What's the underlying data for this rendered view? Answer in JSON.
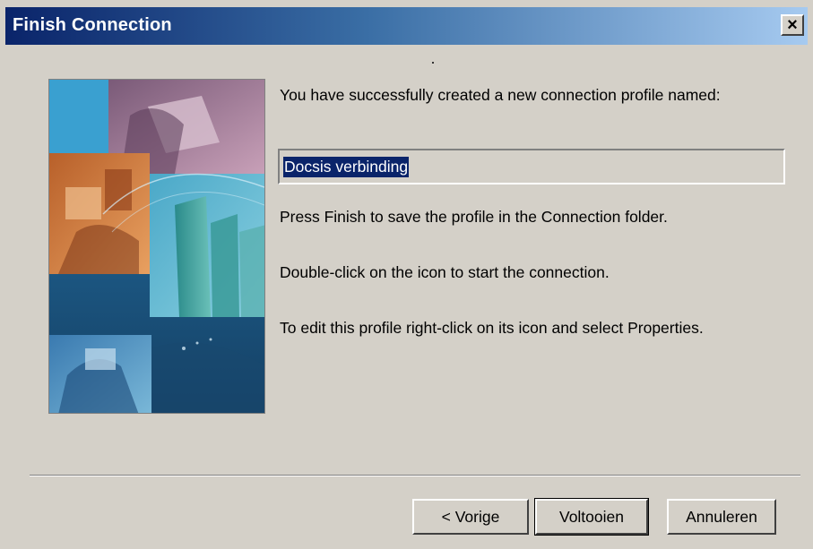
{
  "window": {
    "title": "Finish Connection",
    "close_glyph": "×"
  },
  "content": {
    "intro_text": "You have successfully created a new connection profile named:",
    "profile_name": "Docsis verbinding",
    "line_finish": "Press Finish to save the profile in the Connection folder.",
    "line_doubleclick": "Double-click on the icon to start the connection.",
    "line_edit": "To edit this profile right-click on its icon and select Properties."
  },
  "buttons": {
    "back_label": "< Vorige",
    "finish_label": "Voltooien",
    "cancel_label": "Annuleren"
  },
  "colors": {
    "titlebar_start": "#0a246a",
    "titlebar_end": "#a6caf0",
    "face": "#d4d0c8",
    "selection": "#0a246a"
  }
}
